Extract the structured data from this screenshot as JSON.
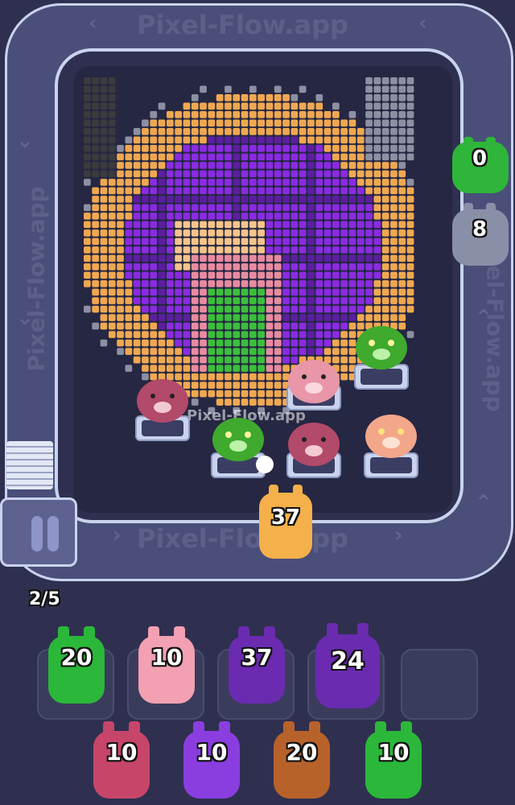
{
  "app": {
    "watermark": "Pixel-Flow.app"
  },
  "hud": {
    "progress": "2/5"
  },
  "track_pigs": [
    {
      "value": "0",
      "color": "#2fb53a"
    },
    {
      "value": "8",
      "color": "#8a8fa8"
    }
  ],
  "launcher": {
    "value": "37",
    "color": "#f4b04a"
  },
  "queue_grid": [
    {
      "value": "20",
      "color": "#2bb83a"
    },
    {
      "value": "10",
      "color": "#f2a0b2"
    },
    {
      "value": "37",
      "color": "#6a2bb0"
    },
    {
      "value": "24",
      "color": "#6a2bb0"
    },
    {
      "value": "",
      "color": ""
    },
    {
      "value": "10",
      "color": "#c8456a"
    },
    {
      "value": "10",
      "color": "#8a3ee0"
    },
    {
      "value": "20",
      "color": "#b8622b"
    },
    {
      "value": "10",
      "color": "#2bb83a"
    }
  ],
  "board_pigs": [
    {
      "kind": "mauve-pig",
      "color": "#b24a6a"
    },
    {
      "kind": "pink-pig",
      "color": "#e896a8"
    },
    {
      "kind": "green-pig",
      "color": "#3faa2e"
    },
    {
      "kind": "green-pig",
      "color": "#3faa2e"
    },
    {
      "kind": "mauve-pig",
      "color": "#b24a6a"
    },
    {
      "kind": "peach-pig",
      "color": "#f2a68a"
    }
  ],
  "palette": {
    "purple": "#8a2be2",
    "dark_purple": "#5a1f9e",
    "orange": "#f0a850",
    "peach": "#f6c48a",
    "dark": "#3a3a3f",
    "grey": "#8d8fa3",
    "green": "#3bbf3b",
    "pink": "#e88ba0",
    "crimson": "#c04060"
  }
}
